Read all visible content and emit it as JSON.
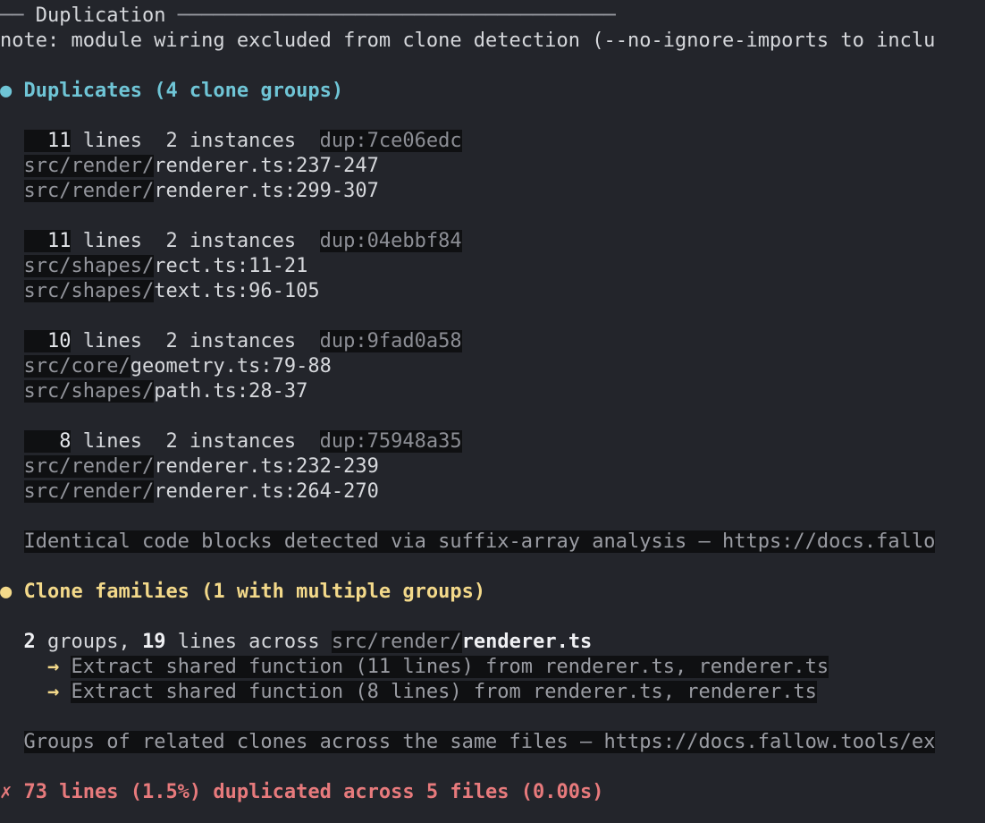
{
  "section": {
    "prefix": "── ",
    "title": "Duplication",
    "rule": " ─────────────────────────────────────"
  },
  "note": "note: module wiring excluded from clone detection (--no-ignore-imports to inclu",
  "duplicates": {
    "bullet": "●",
    "heading": "Duplicates (4 clone groups)",
    "groups": [
      {
        "count": "  11",
        "lines_label": " lines  2 instances  ",
        "hash": "dup:7ce06edc",
        "instances": [
          {
            "dir": "src/render/",
            "file": "renderer.ts:237-247"
          },
          {
            "dir": "src/render/",
            "file": "renderer.ts:299-307"
          }
        ]
      },
      {
        "count": "  11",
        "lines_label": " lines  2 instances  ",
        "hash": "dup:04ebbf84",
        "instances": [
          {
            "dir": "src/shapes/",
            "file": "rect.ts:11-21"
          },
          {
            "dir": "src/shapes/",
            "file": "text.ts:96-105"
          }
        ]
      },
      {
        "count": "  10",
        "lines_label": " lines  2 instances  ",
        "hash": "dup:9fad0a58",
        "instances": [
          {
            "dir": "src/core/",
            "file": "geometry.ts:79-88"
          },
          {
            "dir": "src/shapes/",
            "file": "path.ts:28-37"
          }
        ]
      },
      {
        "count": "   8",
        "lines_label": " lines  2 instances  ",
        "hash": "dup:75948a35",
        "instances": [
          {
            "dir": "src/render/",
            "file": "renderer.ts:232-239"
          },
          {
            "dir": "src/render/",
            "file": "renderer.ts:264-270"
          }
        ]
      }
    ],
    "hint": "Identical code blocks detected via suffix-array analysis — https://docs.fallo"
  },
  "families": {
    "bullet": "●",
    "heading": "Clone families (1 with multiple groups)",
    "summary": {
      "groups_num": "2",
      "groups_text": " groups, ",
      "lines_num": "19",
      "lines_text": " lines across ",
      "dir": "src/render/",
      "file": "renderer.ts"
    },
    "suggestions": [
      {
        "arrow": "→",
        "text": "Extract shared function (11 lines) from renderer.ts, renderer.ts"
      },
      {
        "arrow": "→",
        "text": "Extract shared function (8 lines) from renderer.ts, renderer.ts"
      }
    ],
    "hint": "Groups of related clones across the same files — https://docs.fallow.tools/ex"
  },
  "footer": {
    "icon": "✗",
    "text": "73 lines (1.5%) duplicated across 5 files (0.00s)"
  }
}
